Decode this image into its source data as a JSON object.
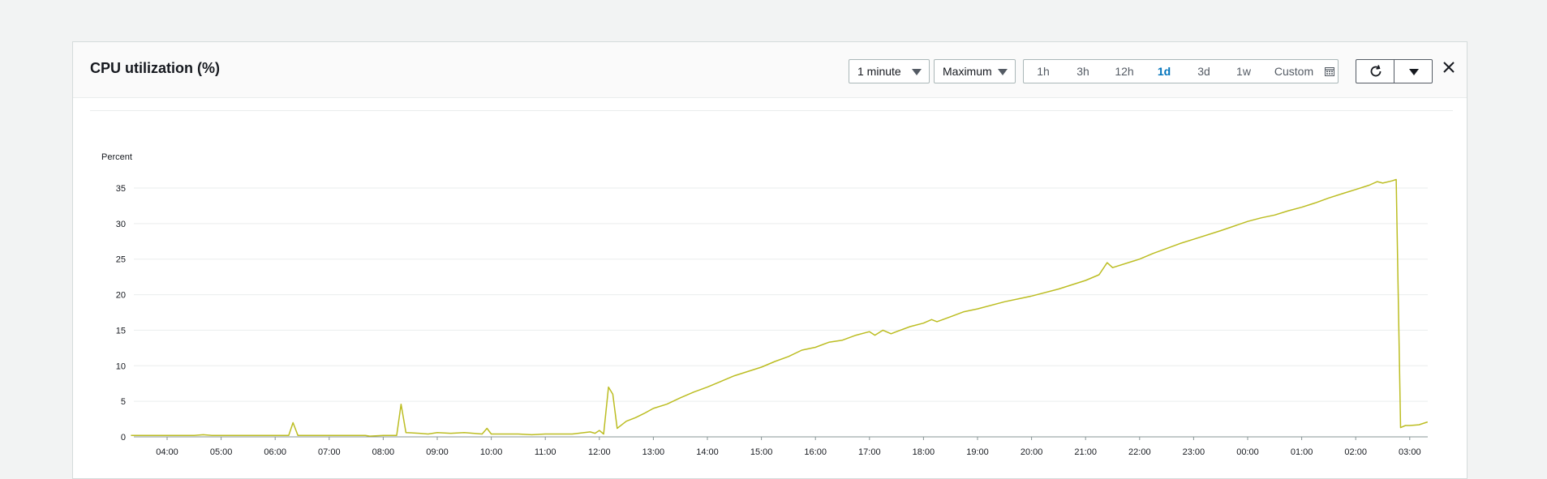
{
  "widget": {
    "title": "CPU utilization (%)",
    "period": "1 minute",
    "statistic": "Maximum",
    "time_ranges": [
      {
        "label": "1h",
        "active": false
      },
      {
        "label": "3h",
        "active": false
      },
      {
        "label": "12h",
        "active": false
      },
      {
        "label": "1d",
        "active": true
      },
      {
        "label": "3d",
        "active": false
      },
      {
        "label": "1w",
        "active": false
      }
    ],
    "custom_label": "Custom",
    "icons": {
      "calendar": "calendar-icon",
      "refresh": "refresh-icon",
      "dropdown": "chevron-down-icon",
      "close": "close-icon"
    }
  },
  "colors": {
    "series": "#bcbd22",
    "active_range": "#0073bb",
    "grid": "#eaeded",
    "axis": "#879596"
  },
  "chart_data": {
    "type": "line",
    "ylabel": "Percent",
    "ylim": [
      0,
      36
    ],
    "yticks": [
      0,
      5,
      10,
      15,
      20,
      25,
      30,
      35
    ],
    "xlabels": [
      "04:00",
      "05:00",
      "06:00",
      "07:00",
      "08:00",
      "09:00",
      "10:00",
      "11:00",
      "12:00",
      "13:00",
      "14:00",
      "15:00",
      "16:00",
      "17:00",
      "18:00",
      "19:00",
      "20:00",
      "21:00",
      "22:00",
      "23:00",
      "00:00",
      "01:00",
      "02:00",
      "03:00"
    ],
    "grid": true,
    "series": [
      {
        "x": [
          3.33,
          4.0,
          4.5,
          4.67,
          4.83,
          5.0,
          6.0,
          6.25,
          6.33,
          6.42,
          7.0,
          7.67,
          7.75,
          8.0,
          8.25,
          8.33,
          8.42,
          8.67,
          8.83,
          9.0,
          9.25,
          9.5,
          9.67,
          9.83,
          9.92,
          10.0,
          10.5,
          10.75,
          11.0,
          11.5,
          11.83,
          11.92,
          12.0,
          12.08,
          12.17,
          12.25,
          12.33,
          12.5,
          12.67,
          12.83,
          13.0,
          13.25,
          13.5,
          13.75,
          14.0,
          14.5,
          15.0,
          15.25,
          15.5,
          15.75,
          16.0,
          16.25,
          16.5,
          16.75,
          17.0,
          17.1,
          17.25,
          17.4,
          17.5,
          17.75,
          18.0,
          18.15,
          18.25,
          18.5,
          18.75,
          19.0,
          19.5,
          20.0,
          20.5,
          21.0,
          21.25,
          21.4,
          21.5,
          22.0,
          22.25,
          22.5,
          22.75,
          23.0,
          23.5,
          24.0,
          24.25,
          24.5,
          24.75,
          25.0,
          25.25,
          25.5,
          25.75,
          26.0,
          26.25,
          26.4,
          26.5,
          26.67,
          26.75,
          26.83,
          26.92,
          27.0,
          27.17,
          27.33
        ],
        "y": [
          0.2,
          0.2,
          0.2,
          0.3,
          0.2,
          0.2,
          0.2,
          0.2,
          2.0,
          0.2,
          0.2,
          0.2,
          0.1,
          0.2,
          0.2,
          4.6,
          0.6,
          0.5,
          0.4,
          0.6,
          0.5,
          0.6,
          0.5,
          0.4,
          1.2,
          0.4,
          0.4,
          0.3,
          0.4,
          0.4,
          0.7,
          0.5,
          0.9,
          0.4,
          7.0,
          6.0,
          1.2,
          2.2,
          2.7,
          3.3,
          4.0,
          4.6,
          5.5,
          6.3,
          7.0,
          8.6,
          9.8,
          10.6,
          11.3,
          12.2,
          12.6,
          13.3,
          13.6,
          14.3,
          14.8,
          14.3,
          15.0,
          14.5,
          14.8,
          15.5,
          16.0,
          16.5,
          16.2,
          16.9,
          17.6,
          18.0,
          19.0,
          19.8,
          20.8,
          22.0,
          22.8,
          24.5,
          23.8,
          25.0,
          25.8,
          26.5,
          27.2,
          27.8,
          29.0,
          30.3,
          30.8,
          31.2,
          31.8,
          32.3,
          32.9,
          33.6,
          34.2,
          34.8,
          35.4,
          35.9,
          35.7,
          36.0,
          36.2,
          1.3,
          1.6,
          1.6,
          1.7,
          2.1
        ]
      }
    ]
  }
}
